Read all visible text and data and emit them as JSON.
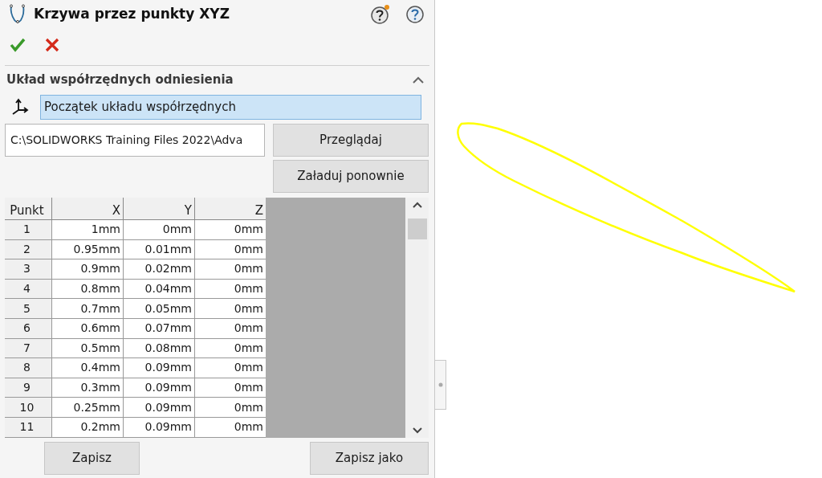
{
  "panel": {
    "title": "Krzywa przez punkty XYZ"
  },
  "section": {
    "title": "Układ współrzędnych odniesienia",
    "expanded": true,
    "reference": "Początek układu współrzędnych",
    "file_path": "C:\\SOLIDWORKS Training Files 2022\\Adva",
    "buttons": [
      "Przeglądaj",
      "Załaduj ponownie"
    ]
  },
  "table": {
    "columns": [
      "Punkt",
      "X",
      "Y",
      "Z"
    ],
    "rows": [
      [
        "1",
        "1mm",
        "0mm",
        "0mm"
      ],
      [
        "2",
        "0.95mm",
        "0.01mm",
        "0mm"
      ],
      [
        "3",
        "0.9mm",
        "0.02mm",
        "0mm"
      ],
      [
        "4",
        "0.8mm",
        "0.04mm",
        "0mm"
      ],
      [
        "5",
        "0.7mm",
        "0.05mm",
        "0mm"
      ],
      [
        "6",
        "0.6mm",
        "0.07mm",
        "0mm"
      ],
      [
        "7",
        "0.5mm",
        "0.08mm",
        "0mm"
      ],
      [
        "8",
        "0.4mm",
        "0.09mm",
        "0mm"
      ],
      [
        "9",
        "0.3mm",
        "0.09mm",
        "0mm"
      ],
      [
        "10",
        "0.25mm",
        "0.09mm",
        "0mm"
      ],
      [
        "11",
        "0.2mm",
        "0.09mm",
        "0mm"
      ]
    ]
  },
  "footer_buttons": [
    "Zapisz",
    "Zapisz jako"
  ]
}
